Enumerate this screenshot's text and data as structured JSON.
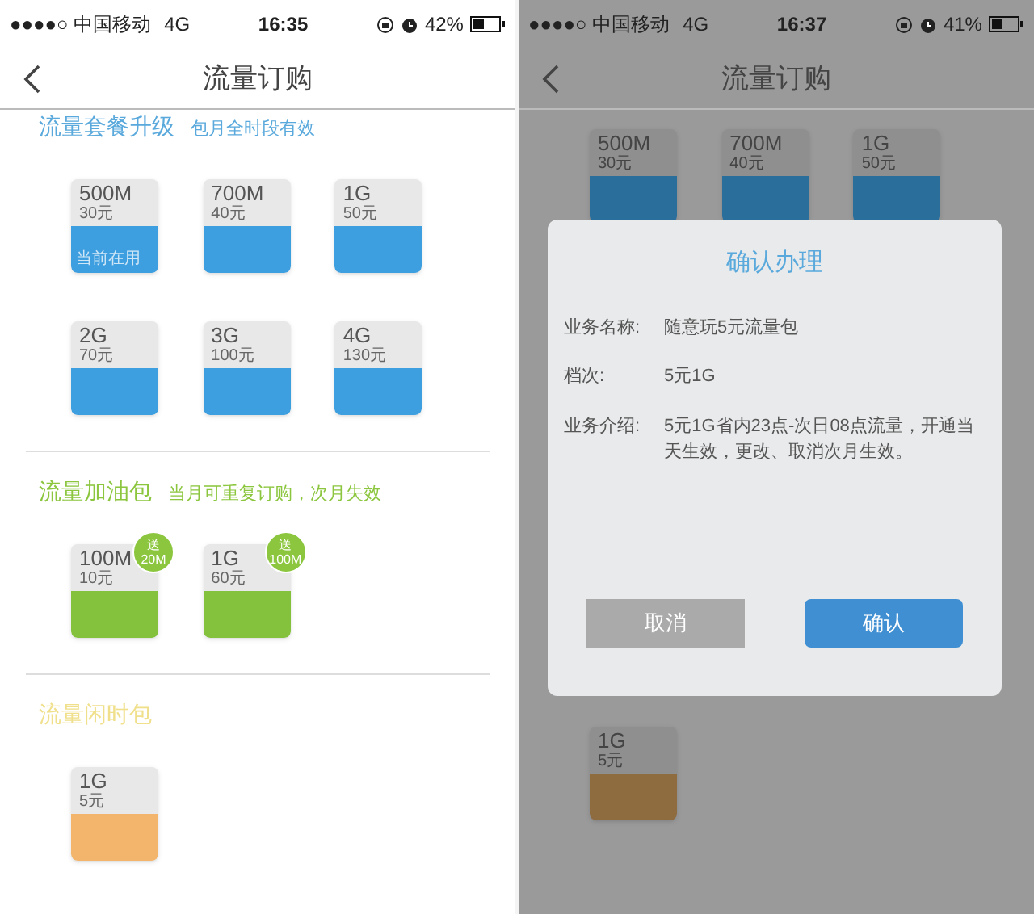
{
  "screens": [
    {
      "dimmed": false,
      "status": {
        "carrier": "●●●●○ 中国移动",
        "network": "4G",
        "time": "16:35",
        "battery": "42%"
      },
      "nav": {
        "title": "流量订购"
      },
      "sections": [
        {
          "kind": "plan",
          "title": "流量套餐升级",
          "note": "包月全时段有效",
          "cards": [
            {
              "size": "500M",
              "price": "30元",
              "label": "当前在用"
            },
            {
              "size": "700M",
              "price": "40元"
            },
            {
              "size": "1G",
              "price": "50元"
            },
            {
              "size": "2G",
              "price": "70元"
            },
            {
              "size": "3G",
              "price": "100元"
            },
            {
              "size": "4G",
              "price": "130元"
            }
          ]
        },
        {
          "kind": "addon",
          "title": "流量加油包",
          "note": "当月可重复订购，次月失效",
          "cards": [
            {
              "size": "100M",
              "price": "10元",
              "badge": [
                "送",
                "20M"
              ]
            },
            {
              "size": "1G",
              "price": "60元",
              "badge": [
                "送",
                "100M"
              ]
            }
          ]
        },
        {
          "kind": "idle",
          "title": "流量闲时包",
          "cards": [
            {
              "size": "1G",
              "price": "5元"
            }
          ]
        }
      ]
    },
    {
      "dimmed": true,
      "status": {
        "carrier": "●●●●○ 中国移动",
        "network": "4G",
        "time": "16:37",
        "battery": "41%"
      },
      "nav": {
        "title": "流量订购"
      },
      "sections": [
        {
          "kind": "plan",
          "cards": [
            {
              "size": "500M",
              "price": "30元"
            },
            {
              "size": "700M",
              "price": "40元"
            },
            {
              "size": "1G",
              "price": "50元"
            }
          ]
        },
        {
          "kind": "idle",
          "cards": [
            {
              "size": "1G",
              "price": "5元"
            }
          ]
        }
      ],
      "dialog": {
        "title": "确认办理",
        "rows": [
          {
            "label": "业务名称:",
            "value": "随意玩5元流量包"
          },
          {
            "label": "档次:",
            "value": "5元1G"
          },
          {
            "label": "业务介绍:",
            "value": "5元1G省内23点-次日08点流量，开通当天生效，更改、取消次月生效。"
          }
        ],
        "buttons": [
          {
            "kind": "secondary",
            "label": "取消"
          },
          {
            "kind": "primary",
            "label": "确认"
          }
        ]
      }
    }
  ]
}
